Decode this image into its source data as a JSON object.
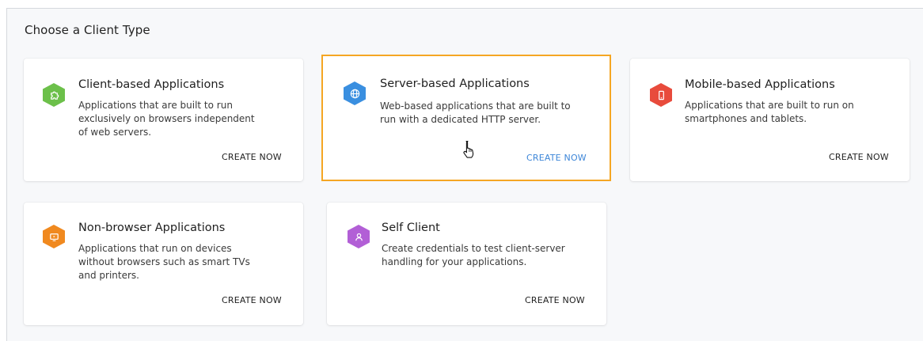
{
  "page": {
    "title": "Choose a Client Type"
  },
  "cards": [
    {
      "title": "Client-based Applications",
      "description": "Applications that are built to run exclusively on browsers independent of web servers.",
      "action": "CREATE NOW",
      "icon": "puzzle-icon",
      "color": "#6cc04a"
    },
    {
      "title": "Server-based Applications",
      "description": "Web-based applications that are built to run with a dedicated HTTP server.",
      "action": "CREATE NOW",
      "icon": "globe-icon",
      "color": "#3a8fe0"
    },
    {
      "title": "Mobile-based Applications",
      "description": "Applications that are built to run on smartphones and tablets.",
      "action": "CREATE NOW",
      "icon": "mobile-phone-icon",
      "color": "#e84b3c"
    },
    {
      "title": "Non-browser Applications",
      "description": "Applications that run on devices without browsers such as smart TVs and printers.",
      "action": "CREATE NOW",
      "icon": "tv-icon",
      "color": "#f0891f"
    },
    {
      "title": "Self Client",
      "description": "Create credentials to test client-server handling for your applications.",
      "action": "CREATE NOW",
      "icon": "user-icon",
      "color": "#b25fd6"
    }
  ],
  "colors": {
    "selected_border": "#f5a623",
    "active_link": "#3d86d8"
  }
}
